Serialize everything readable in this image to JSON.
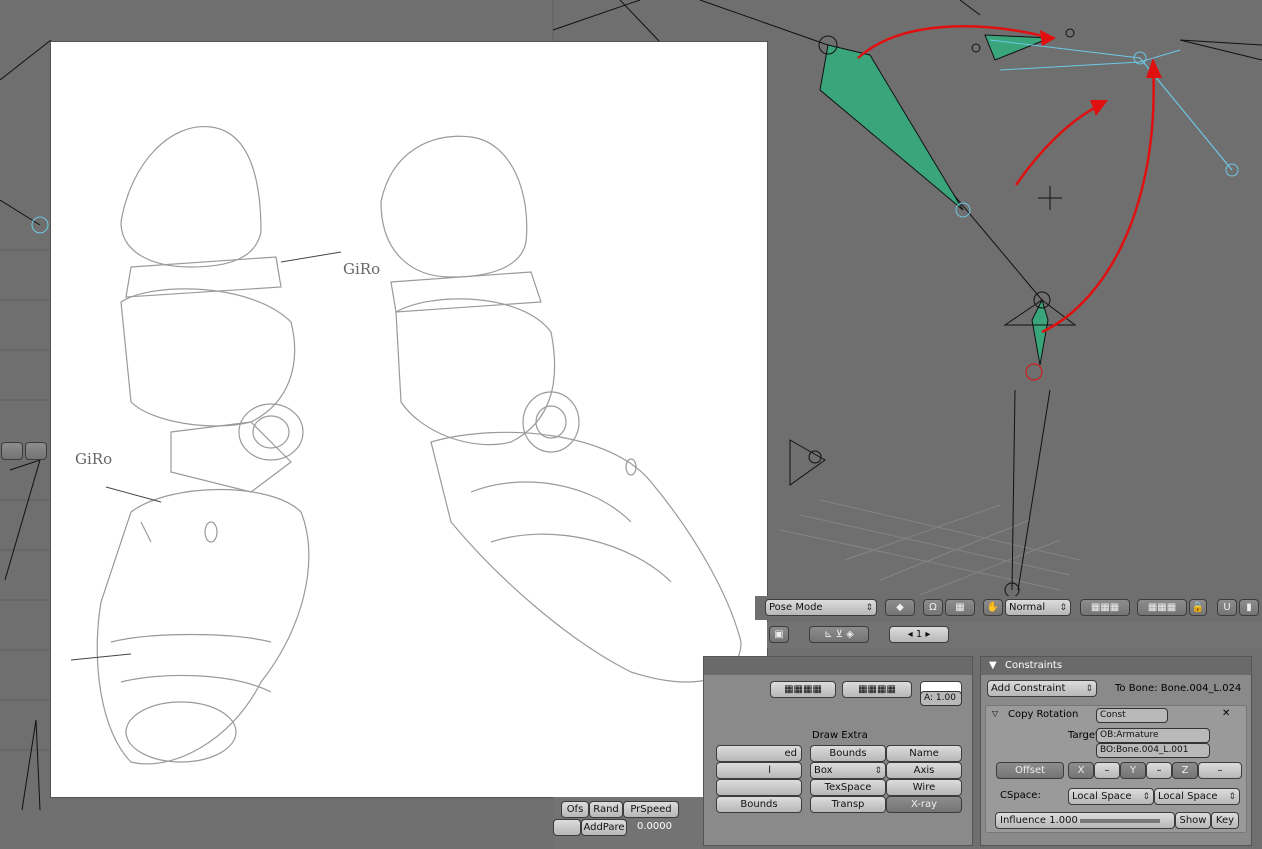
{
  "viewport_header": {
    "mode": "Pose Mode",
    "draw_type": "Normal",
    "frame": "1"
  },
  "sketch": {
    "annotation_top": "GiRo",
    "annotation_left": "GiRo"
  },
  "left_panel": {
    "buttons": [
      "Ofs",
      "Rand",
      "PrSpeed",
      "AddPare"
    ],
    "value": "0.0000"
  },
  "draw_panel": {
    "alpha_label": "A: 1.00",
    "draw_extra_label": "Draw Extra",
    "partial_label_1": "ed",
    "partial_label_2": "l",
    "bounds_left": "Bounds",
    "bounds": "Bounds",
    "name": "Name",
    "box": "Box",
    "axis": "Axis",
    "texspace": "TexSpace",
    "wire": "Wire",
    "transp": "Transp",
    "xray": "X-ray"
  },
  "constraints_panel": {
    "title": "Constraints",
    "add_constraint": "Add Constraint",
    "to_bone": "To Bone: Bone.004_L.024",
    "constraint_type": "Copy Rotation",
    "constraint_name": "Const",
    "target_label": "Target:",
    "target_object": "OB:Armature",
    "target_bone": "BO:Bone.004_L.001",
    "offset": "Offset",
    "axes": [
      "X",
      "–",
      "Y",
      "–",
      "Z",
      "–"
    ],
    "cspace_label": "CSpace:",
    "cspace_owner": "Local Space",
    "cspace_target": "Local Space",
    "influence": "Influence 1.000",
    "influence_value": 1.0,
    "show": "Show",
    "key": "Key"
  },
  "colors": {
    "viewport_bg": "#6f6f6f",
    "bone_selected": "#3aa47a",
    "bone_highlight": "#6ec7e6",
    "annotation_arrow": "#e01010"
  }
}
